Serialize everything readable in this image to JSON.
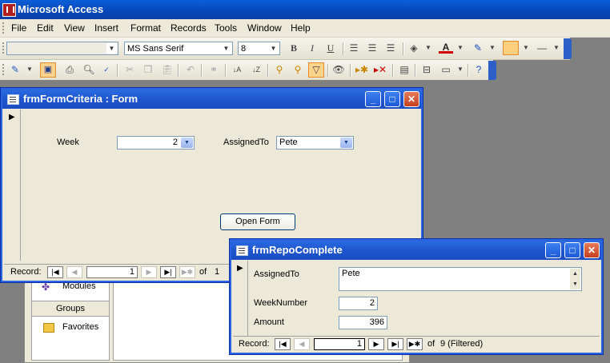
{
  "app": {
    "title": "Microsoft Access"
  },
  "menu": [
    "File",
    "Edit",
    "View",
    "Insert",
    "Format",
    "Records",
    "Tools",
    "Window",
    "Help"
  ],
  "formatting_toolbar": {
    "object_combo": "",
    "font": "MS Sans Serif",
    "size": "8",
    "bold": "B",
    "italic": "I",
    "underline": "U"
  },
  "form_criteria": {
    "title": "frmFormCriteria : Form",
    "week_label": "Week",
    "week_value": "2",
    "assigned_label": "AssignedTo",
    "assigned_value": "Pete",
    "open_button": "Open Form",
    "record_label": "Record:",
    "record_value": "1",
    "record_of": "of",
    "record_total": "1"
  },
  "db_window": {
    "modules": "Modules",
    "groups": "Groups",
    "favorites": "Favorites"
  },
  "repo_complete": {
    "title": "frmRepoComplete",
    "assigned_label": "AssignedTo",
    "assigned_value": "Pete",
    "week_label": "WeekNumber",
    "week_value": "2",
    "amount_label": "Amount",
    "amount_value": "396",
    "record_label": "Record:",
    "record_value": "1",
    "record_of": "of",
    "record_total": "9 (Filtered)"
  }
}
